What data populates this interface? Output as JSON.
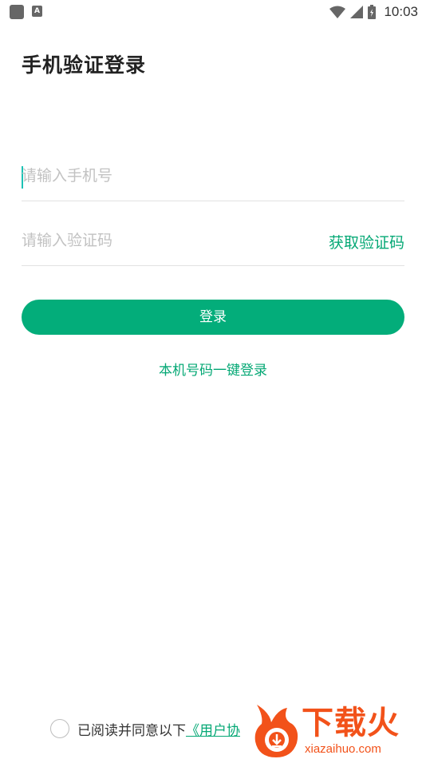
{
  "status_bar": {
    "time": "10:03",
    "icons": [
      "app-square-icon",
      "keyboard-a-icon",
      "wifi-icon",
      "signal-icon",
      "battery-icon"
    ]
  },
  "page": {
    "title": "手机验证登录"
  },
  "phone_field": {
    "placeholder": "请输入手机号",
    "value": ""
  },
  "code_field": {
    "placeholder": "请输入验证码",
    "value": "",
    "get_code_label": "获取验证码"
  },
  "login_button": {
    "label": "登录"
  },
  "one_click_login": {
    "label": "本机号码一键登录"
  },
  "agreement": {
    "prefix": "已阅读并同意以下",
    "link": "《用户协"
  },
  "watermark": {
    "brand": "下载火",
    "url": "xiazaihuo.com"
  },
  "colors": {
    "accent": "#03ad7a",
    "link": "#05a875",
    "cursor": "#1cc2b5",
    "watermark": "#f2521a"
  }
}
